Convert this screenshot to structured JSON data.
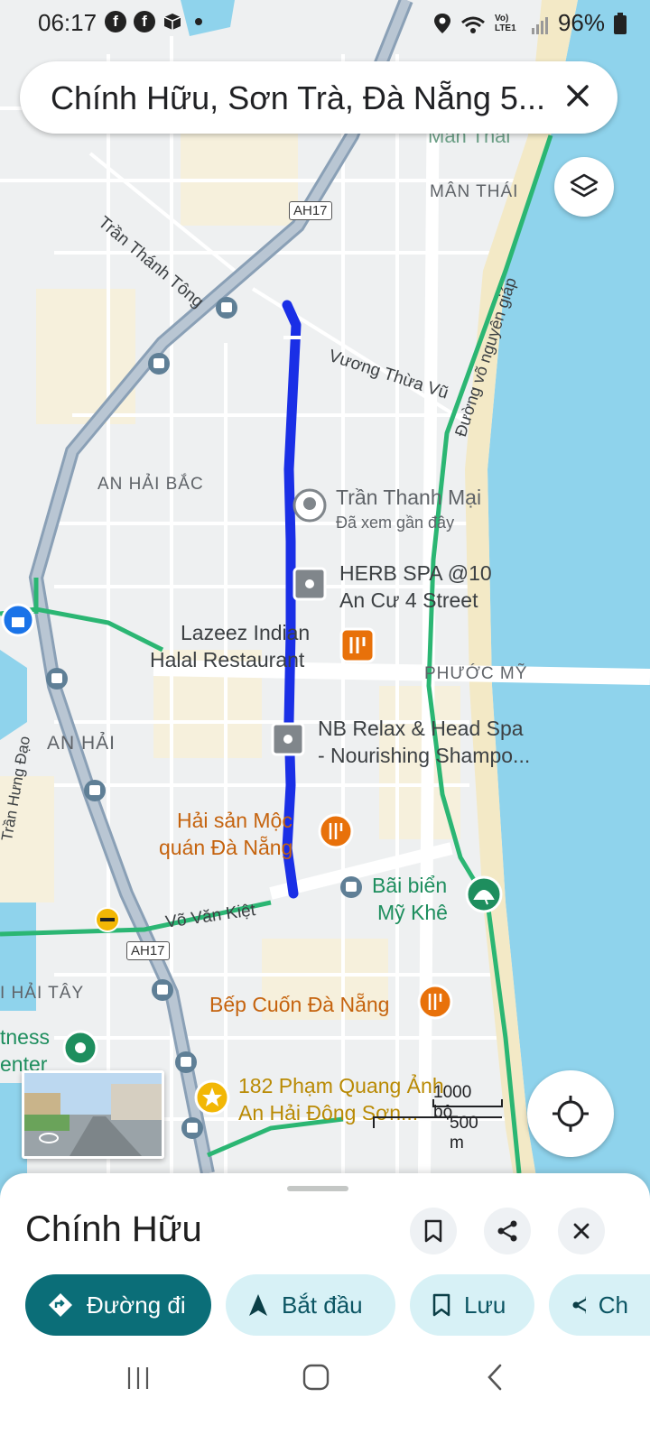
{
  "status_bar": {
    "time": "06:17",
    "battery": "96%",
    "icons_left": [
      "facebook-icon",
      "facebook-icon",
      "box-icon",
      "dot-icon"
    ],
    "icons_right": [
      "location-icon",
      "wifi-icon",
      "volte-icon",
      "signal-icon",
      "battery-icon"
    ],
    "volte_label": "Vo) LTE1"
  },
  "search": {
    "text": "Chính Hữu, Sơn Trà, Đà Nẵng 5..."
  },
  "map": {
    "areas": {
      "an_hai_bac": "AN HẢI BẮC",
      "man_thai": "MÂN THÁI",
      "man_thai_top": "Mân Thái",
      "phuoc_my": "PHƯỚC MỸ",
      "an_hai": "AN HẢI",
      "an_hai_tay": "I HẢI TÂY"
    },
    "roads": {
      "tran_thanh_tong": "Trần Thánh Tông",
      "vuong_thua_vu": "Vương Thừa Vũ",
      "vo_nguyen_giap": "Đường võ nguyên giáp",
      "vo_van_kiet": "Võ Văn Kiệt",
      "tran_hung_dao": "Trần Hưng Đạo",
      "ah17_top": "AH17",
      "ah17_bottom": "AH17"
    },
    "places": {
      "tran_thanh_mai": "Trần Thanh Mại",
      "tran_thanh_mai_sub": "Đã xem gần đây",
      "herb_spa_1": "HERB SPA @10",
      "herb_spa_2": "An Cư 4 Street",
      "lazeez_1": "Lazeez Indian",
      "lazeez_2": "Halal Restaurant",
      "nb_relax_1": "NB Relax & Head Spa",
      "nb_relax_2": "- Nourishing Shampo...",
      "hai_san_1": "Hải sản Mộc",
      "hai_san_2": "quán Đà Nẵng",
      "bai_bien_1": "Bãi biển",
      "bai_bien_2": "Mỹ Khê",
      "bep_cuon": "Bếp Cuốn Đà Nẵng",
      "pham_quang_anh_1": "182 Phạm Quang Ảnh",
      "pham_quang_anh_2": "An Hải Đông Sơn...",
      "fitness_1": "tness",
      "fitness_2": "enter"
    },
    "scale": {
      "imperial": "1000 bộ",
      "metric": "500 m"
    },
    "colors": {
      "route": "#1a2fe6",
      "water": "#8fd3ec",
      "green_road": "#2bb673",
      "food": "#e8710a",
      "attraction": "#1e8e5e"
    }
  },
  "sheet": {
    "title": "Chính Hữu",
    "chips": {
      "directions": "Đường đi",
      "start": "Bắt đầu",
      "save": "Lưu",
      "share": "Ch"
    }
  }
}
